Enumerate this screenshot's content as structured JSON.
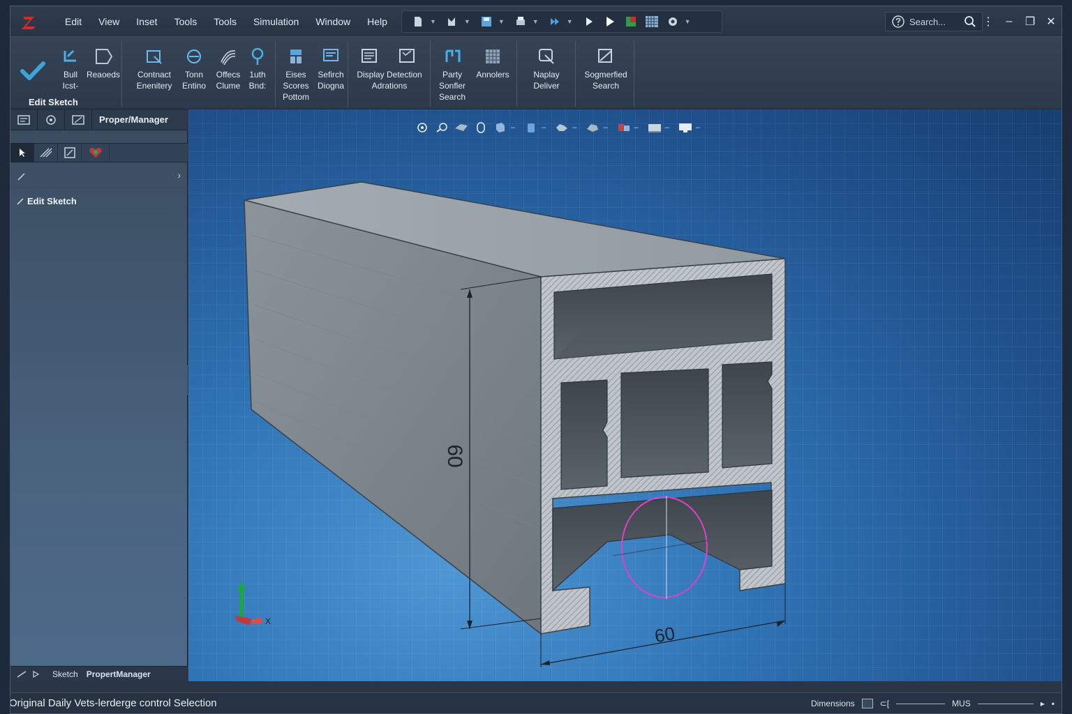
{
  "menu": {
    "items": [
      "Edit",
      "View",
      "Inset",
      "Tools",
      "Tools",
      "Simulation",
      "Window",
      "Help"
    ]
  },
  "search": {
    "placeholder": "Search..."
  },
  "ribbon": {
    "edit_sketch_label": "Edit Sketch",
    "buttons": [
      {
        "label": "Bull\nIcst-"
      },
      {
        "label": "Reaoeds"
      },
      {
        "label": "Contnact\nEnenitery"
      },
      {
        "label": "Tonn\nEntino"
      },
      {
        "label": "Offecs\nClume"
      },
      {
        "label": "1uth\nBnd:"
      },
      {
        "label": "Eises\nScores\nPottom"
      },
      {
        "label": "Sefirch\nDiogna"
      },
      {
        "label": "Display Detection\nAdrations"
      },
      {
        "label": "Party\nSonfler\nSearch"
      },
      {
        "label": "Annolers"
      },
      {
        "label": "Naplay\nDeliver"
      },
      {
        "label": "Sogmerfied\nSearch"
      }
    ]
  },
  "left_panel": {
    "title": "Proper/Manager",
    "edit_sketch": "Edit Sketch",
    "bottom_tab1": "Sketch",
    "bottom_tab2": "PropertManager"
  },
  "viewport": {
    "dim_height": "60",
    "dim_width": "60",
    "axis_x": "X"
  },
  "status": {
    "left": "Original Daily Vets-lerderge control Selection",
    "dimensions": "Dimensions",
    "units": "MUS"
  },
  "colors": {
    "accent": "#2d7fc4",
    "check": "#3ea3d8",
    "sketch_circle": "#e040c8"
  }
}
